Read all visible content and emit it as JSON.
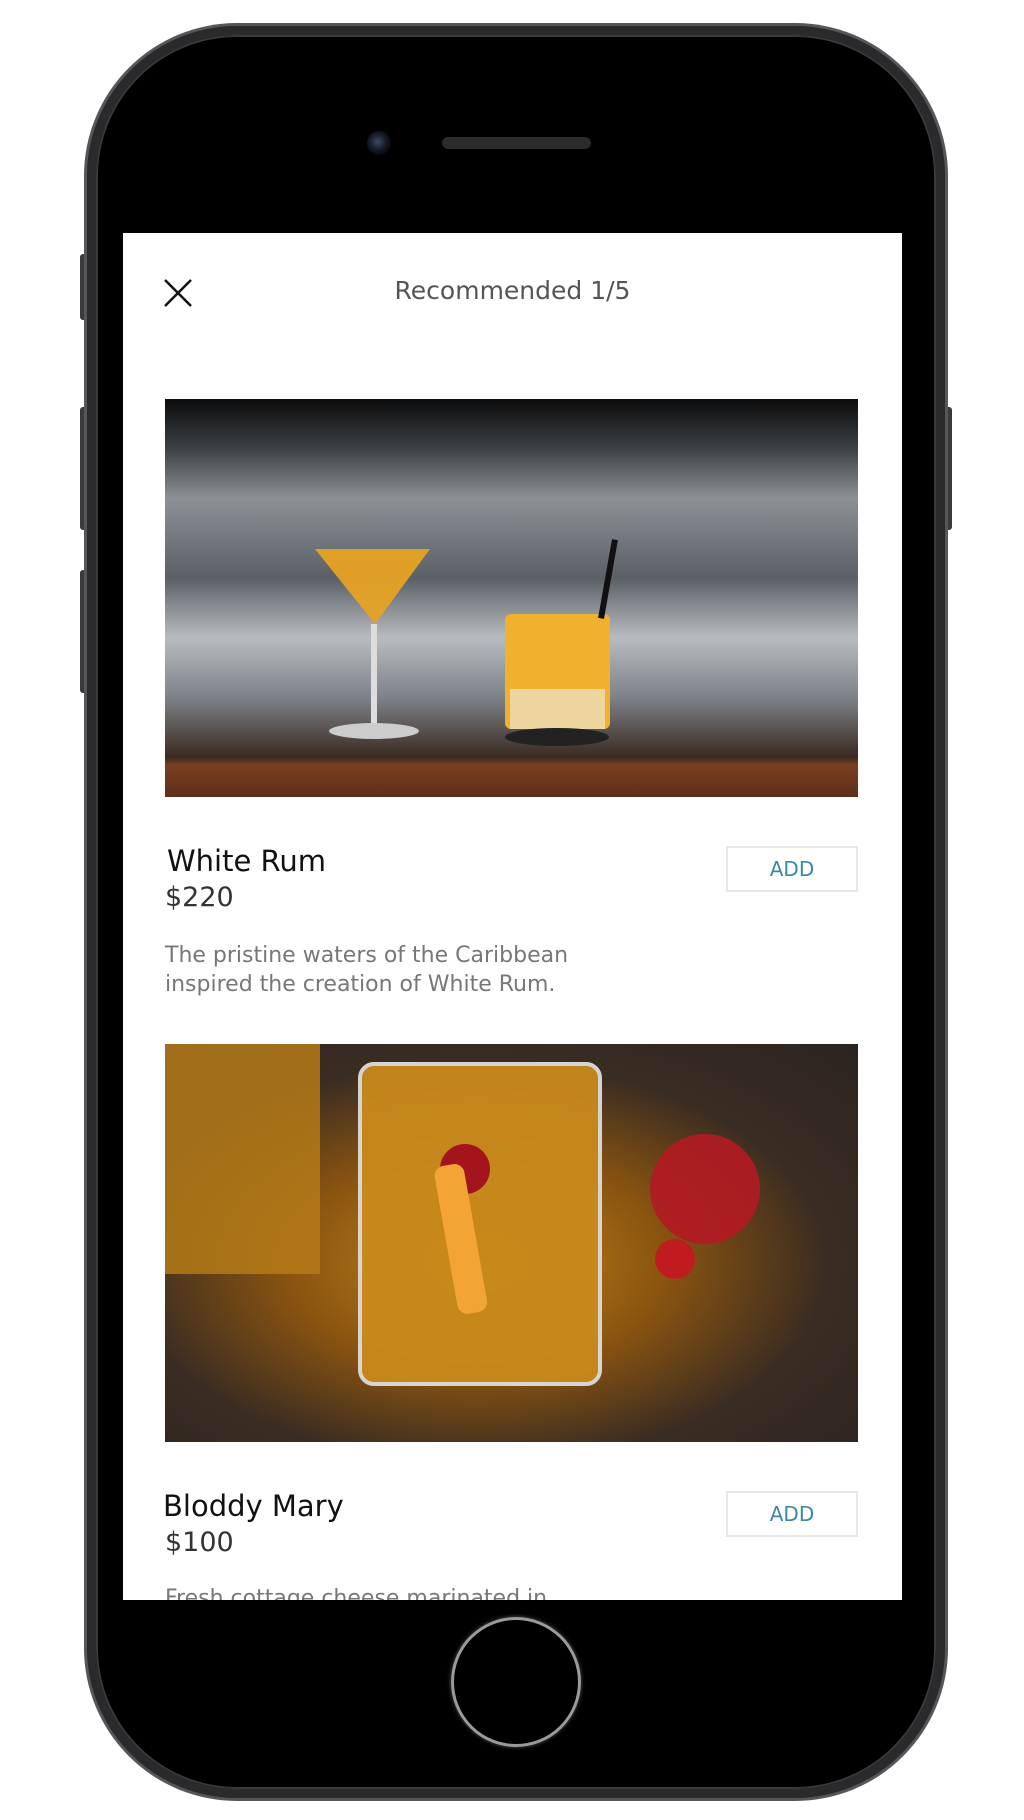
{
  "header": {
    "title": "Recommended 1/5",
    "close_icon": "close-icon"
  },
  "items": [
    {
      "name": "White Rum",
      "price": "$220",
      "add_label": "ADD",
      "description_lines": [
        "The pristine waters of the Caribbean",
        "inspired the creation of White Rum."
      ]
    },
    {
      "name": "Bloddy Mary",
      "price": "$100",
      "add_label": "ADD",
      "description_lines": [
        "Fresh cottage cheese marinated in"
      ]
    }
  ],
  "colors": {
    "accent": "#3b88a8",
    "text": "#111111",
    "muted": "#777777"
  }
}
